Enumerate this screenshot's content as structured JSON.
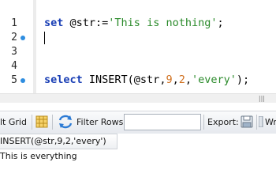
{
  "editor": {
    "line_numbers": [
      "1",
      "2",
      "3",
      "4",
      "5"
    ],
    "line1": {
      "kw": "set",
      "var": " @str:=",
      "str": "'This is nothing'",
      "end": ";"
    },
    "line5": {
      "kw": "select",
      "fn": " INSERT(@str,",
      "n1": "9",
      "c1": ",",
      "n2": "2",
      "c2": ",",
      "str": "'every'",
      "end": ");"
    }
  },
  "toolbar": {
    "result_grid_label": "lt Grid",
    "filter_rows_label": "Filter Rows:",
    "filter_rows_value": "",
    "export_label": "Export:",
    "wrap_label": "Wr"
  },
  "result": {
    "column_header": "INSERT(@str,9,2,'every')",
    "rows": [
      "This is everything"
    ]
  }
}
